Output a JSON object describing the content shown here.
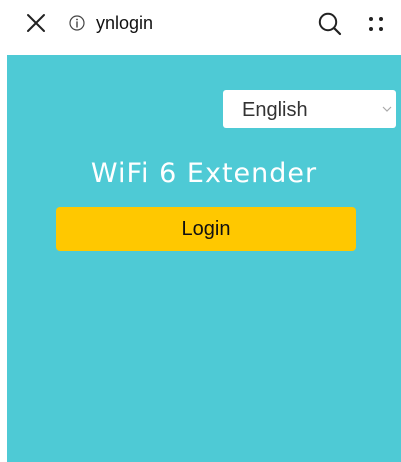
{
  "browser": {
    "address": "ynlogin"
  },
  "page": {
    "language": {
      "selected": "English"
    },
    "product_title": "WiFi 6 Extender",
    "login_label": "Login"
  },
  "colors": {
    "background": "#4ecad5",
    "login_button": "#ffc800",
    "title_text": "#ffffff"
  },
  "icons": {
    "close": "close-icon",
    "info": "info-icon",
    "search": "search-icon",
    "more": "more-icon",
    "chevron": "chevron-down-icon"
  }
}
